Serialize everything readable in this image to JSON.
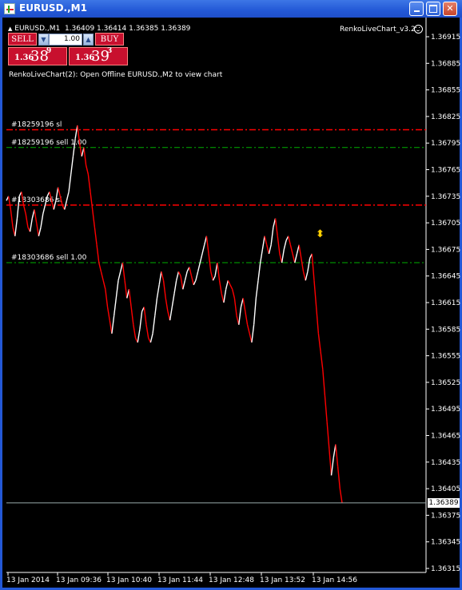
{
  "window": {
    "title": "EURUSD.,M1",
    "buttons": {
      "minimize": "minimize",
      "maximize": "maximize",
      "close": "close"
    }
  },
  "chart_header": {
    "symbol_line": "EURUSD.,M1  1.36409 1.36414 1.36385 1.36389",
    "expert_name": "RenkoLiveChart_v3.2",
    "info_line": "RenkoLiveChart(2): Open Offline EURUSD.,M2 to view chart"
  },
  "one_click": {
    "sell_label": "SELL",
    "buy_label": "BUY",
    "lot_value": "1.00",
    "sell_price": {
      "prefix": "1.36",
      "big": "38",
      "sup": "9"
    },
    "buy_price": {
      "prefix": "1.36",
      "big": "39",
      "sup": "3"
    }
  },
  "levels": [
    {
      "label": "#18259196 sl",
      "price": 1.3681,
      "style": "sl"
    },
    {
      "label": "#18259196 sell 1.00",
      "price": 1.3679,
      "style": "entry"
    },
    {
      "label": "#18303686 sl",
      "price": 1.36725,
      "style": "sl"
    },
    {
      "label": "#18303686 sell 1.00",
      "price": 1.3666,
      "style": "entry"
    }
  ],
  "current_price": "1.36389",
  "colors": {
    "up": "#ffffff",
    "down": "#ff0000",
    "sl": "#ff0000",
    "entry": "#00b000",
    "grid": "#808080"
  },
  "chart_data": {
    "type": "line",
    "title": "EURUSD.,M1",
    "y_ticks": [
      "1.36915",
      "1.36885",
      "1.36855",
      "1.36825",
      "1.36795",
      "1.36765",
      "1.36735",
      "1.36705",
      "1.36675",
      "1.36645",
      "1.36615",
      "1.36585",
      "1.36555",
      "1.36525",
      "1.36495",
      "1.36465",
      "1.36435",
      "1.36405",
      "1.36375",
      "1.36345",
      "1.36315"
    ],
    "x_ticks": [
      "13 Jan 2014",
      "13 Jan 09:36",
      "13 Jan 10:40",
      "13 Jan 11:44",
      "13 Jan 12:48",
      "13 Jan 13:52",
      "13 Jan 14:56"
    ],
    "ylim": [
      1.36305,
      1.36935
    ],
    "series": [
      {
        "values": [
          1.3673,
          1.36735,
          1.3672,
          1.367,
          1.3669,
          1.3671,
          1.36735,
          1.3674,
          1.36725,
          1.36715,
          1.367,
          1.36695,
          1.3671,
          1.3672,
          1.36705,
          1.3669,
          1.367,
          1.36715,
          1.36725,
          1.36735,
          1.3674,
          1.3673,
          1.3672,
          1.3673,
          1.36745,
          1.36735,
          1.36725,
          1.3672,
          1.3673,
          1.3674,
          1.3676,
          1.3678,
          1.368,
          1.36815,
          1.36795,
          1.3678,
          1.3679,
          1.3677,
          1.3676,
          1.3674,
          1.3672,
          1.367,
          1.3668,
          1.3666,
          1.3665,
          1.3664,
          1.3663,
          1.3661,
          1.36595,
          1.3658,
          1.366,
          1.3662,
          1.3664,
          1.3665,
          1.3666,
          1.3664,
          1.3662,
          1.3663,
          1.3661,
          1.3659,
          1.36575,
          1.3657,
          1.36585,
          1.36605,
          1.3661,
          1.3659,
          1.36575,
          1.3657,
          1.3658,
          1.366,
          1.3662,
          1.36635,
          1.3665,
          1.3664,
          1.3662,
          1.36605,
          1.36595,
          1.3661,
          1.36625,
          1.3664,
          1.3665,
          1.36645,
          1.3663,
          1.3664,
          1.3665,
          1.36655,
          1.36645,
          1.36635,
          1.3664,
          1.3665,
          1.3666,
          1.3667,
          1.3668,
          1.3669,
          1.3667,
          1.3665,
          1.3664,
          1.36645,
          1.3666,
          1.3664,
          1.36625,
          1.36615,
          1.3663,
          1.3664,
          1.36635,
          1.3663,
          1.3662,
          1.366,
          1.3659,
          1.3661,
          1.3662,
          1.36605,
          1.3659,
          1.3658,
          1.3657,
          1.3659,
          1.3662,
          1.3664,
          1.3666,
          1.36675,
          1.3669,
          1.3668,
          1.3667,
          1.3668,
          1.367,
          1.3671,
          1.3669,
          1.3667,
          1.3666,
          1.36675,
          1.36685,
          1.3669,
          1.3668,
          1.3667,
          1.3666,
          1.3667,
          1.3668,
          1.36665,
          1.3665,
          1.3664,
          1.3665,
          1.36665,
          1.3667,
          1.3664,
          1.3661,
          1.3658,
          1.3656,
          1.3654,
          1.3651,
          1.3648,
          1.3645,
          1.3642,
          1.3644,
          1.36455,
          1.3643,
          1.36405,
          1.36389
        ]
      }
    ]
  }
}
